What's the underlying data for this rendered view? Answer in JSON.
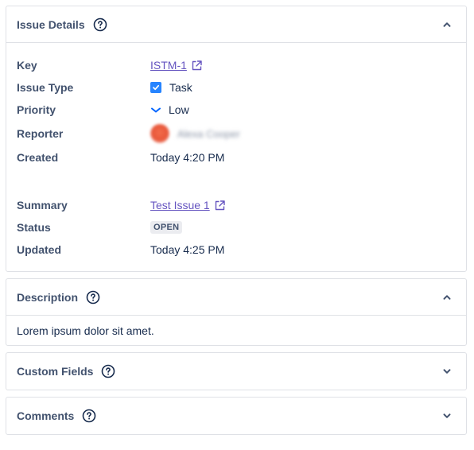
{
  "issue_details": {
    "title": "Issue Details",
    "fields": {
      "key": {
        "label": "Key",
        "value": "ISTM-1"
      },
      "issue_type": {
        "label": "Issue Type",
        "value": "Task"
      },
      "priority": {
        "label": "Priority",
        "value": "Low"
      },
      "reporter": {
        "label": "Reporter",
        "value": "Alexa Cooper"
      },
      "created": {
        "label": "Created",
        "value": "Today 4:20 PM"
      },
      "summary": {
        "label": "Summary",
        "value": "Test Issue 1"
      },
      "status": {
        "label": "Status",
        "value": "OPEN"
      },
      "updated": {
        "label": "Updated",
        "value": "Today 4:25 PM"
      }
    }
  },
  "description": {
    "title": "Description",
    "text": "Lorem ipsum dolor sit amet."
  },
  "custom_fields": {
    "title": "Custom Fields"
  },
  "comments": {
    "title": "Comments"
  },
  "colors": {
    "link": "#6554c0",
    "checkbox": "#2684ff",
    "priority_low": "#0065ff",
    "label": "#42526e",
    "border": "#dfe1e6"
  }
}
